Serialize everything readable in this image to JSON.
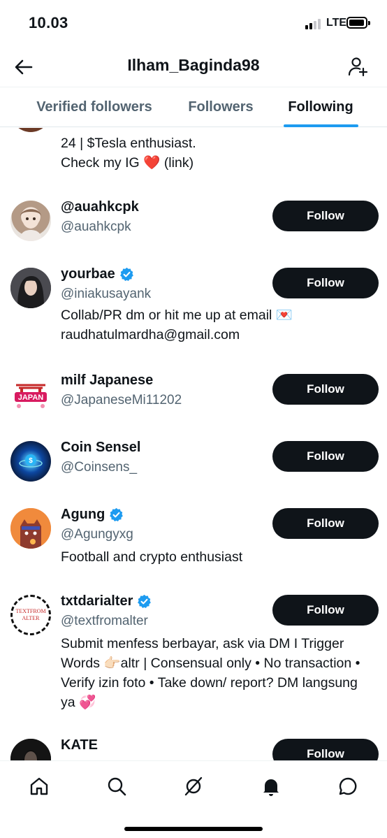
{
  "status_bar": {
    "time": "10.03",
    "network": "LTE"
  },
  "header": {
    "title": "Ilham_Baginda98"
  },
  "tabs": [
    {
      "label": "Verified followers",
      "active": false
    },
    {
      "label": "Followers",
      "active": false
    },
    {
      "label": "Following",
      "active": true
    }
  ],
  "accent_color": "#1d9bf0",
  "partial_bio": {
    "line1": "24 | $Tesla enthusiast.",
    "line2_prefix": "Check my IG",
    "line2_emoji": "❤️",
    "line2_suffix": "(link)"
  },
  "users": [
    {
      "name": "@auahkcpk",
      "handle": "@auahkcpk",
      "verified": false,
      "button": "Follow",
      "bio": ""
    },
    {
      "name": "yourbae",
      "handle": "@iniakusayank",
      "verified": true,
      "button": "Follow",
      "bio": "Collab/PR dm or hit me up at email 💌 raudhatulmardha@gmail.com"
    },
    {
      "name": "milf Japanese",
      "handle": "@JapaneseMi11202",
      "verified": false,
      "button": "Follow",
      "bio": ""
    },
    {
      "name": "Coin Sensel",
      "handle": "@Coinsens_",
      "verified": false,
      "button": "Follow",
      "bio": ""
    },
    {
      "name": "Agung",
      "handle": "@Agungyxg",
      "verified": true,
      "button": "Follow",
      "bio": "Football and crypto enthusiast"
    },
    {
      "name": "txtdarialter",
      "handle": "@textfromalter",
      "verified": true,
      "button": "Follow",
      "bio": "Submit menfess berbayar, ask via DM I Trigger Words 👉🏻altr | Consensual only • No transaction • Verify izin foto • Take down/ report? DM langsung ya 💞"
    },
    {
      "name": "KATE",
      "handle": "",
      "verified": false,
      "button": "Follow",
      "bio": ""
    }
  ],
  "avatar_text": {
    "txtdarialter": "TEXTFROM ALTER",
    "milf_japanese": "JAPAN"
  },
  "bottom_nav": [
    "home-icon",
    "search-icon",
    "grok-icon",
    "notifications-icon",
    "messages-icon"
  ]
}
